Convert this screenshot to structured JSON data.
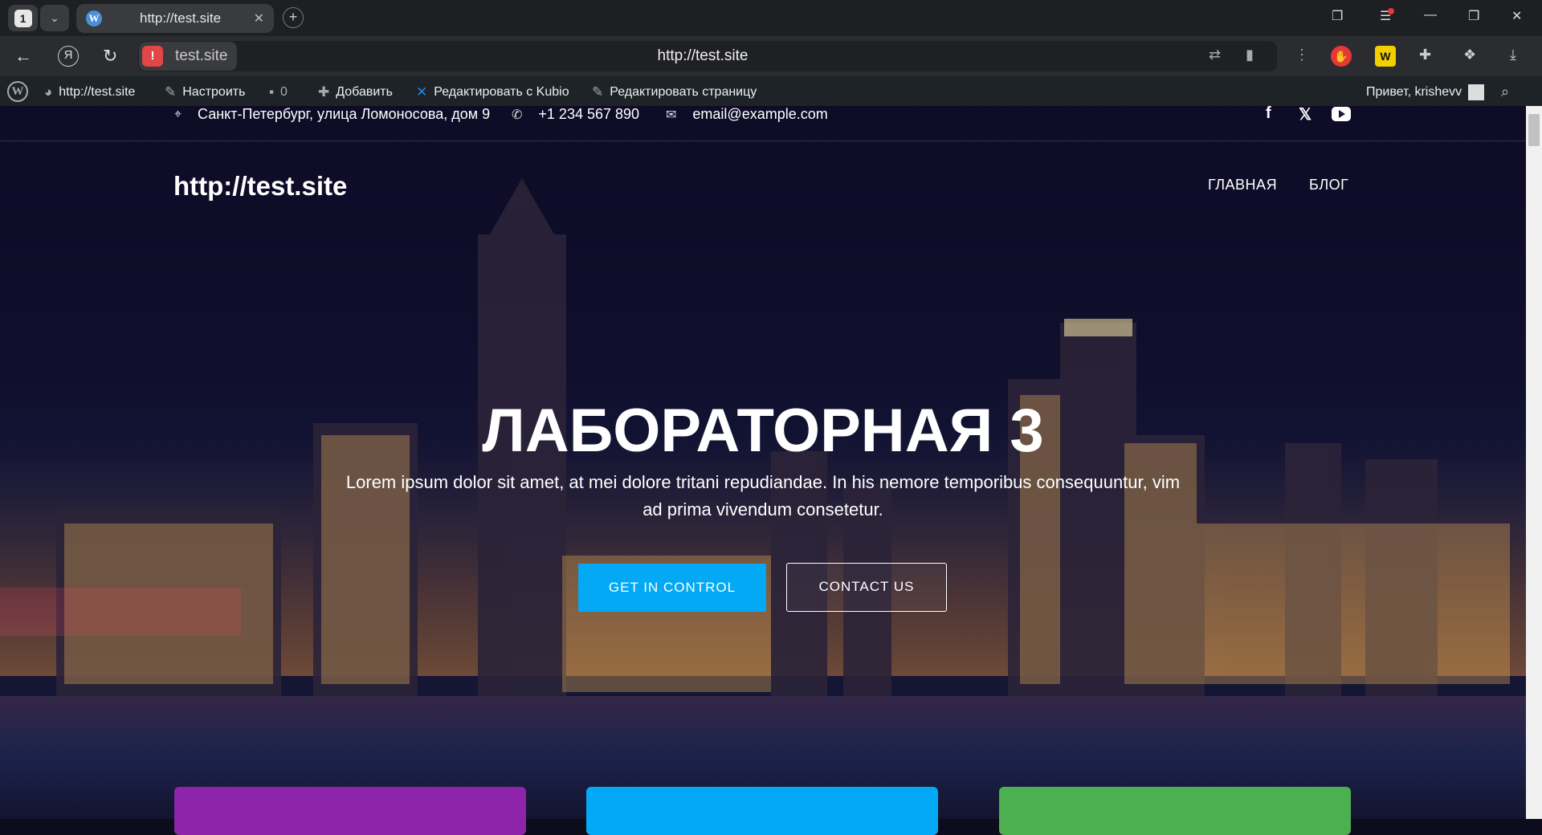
{
  "browser": {
    "tab_count": "1",
    "tab_title": "http://test.site",
    "site_chip": "test.site",
    "url": "http://test.site"
  },
  "adminbar": {
    "site": "http://test.site",
    "customize": "Настроить",
    "comments": "0",
    "add_new": "Добавить",
    "edit_kubio": "Редактировать с Kubio",
    "edit_page": "Редактировать страницу",
    "greeting": "Привет, krishevv"
  },
  "topbar": {
    "address": "Санкт-Петербург, улица Ломоносова, дом 9",
    "phone": "+1 234 567 890",
    "email": "email@example.com"
  },
  "header": {
    "logo": "http://test.site",
    "menu": [
      {
        "label": "ГЛАВНАЯ"
      },
      {
        "label": "БЛОГ"
      }
    ]
  },
  "hero": {
    "title": "ЛАБОРАТОРНАЯ 3",
    "subtitle": "Lorem ipsum dolor sit amet, at mei dolore tritani repudiandae. In his nemore temporibus consequuntur, vim ad prima vivendum consetetur.",
    "primary_button": "GET IN CONTROL",
    "secondary_button": "CONTACT US"
  },
  "colors": {
    "primary": "#03a9f4",
    "card_purple": "#8e24aa",
    "card_blue": "#03a9f4",
    "card_green": "#4caf50",
    "adminbar": "#1d2327"
  }
}
